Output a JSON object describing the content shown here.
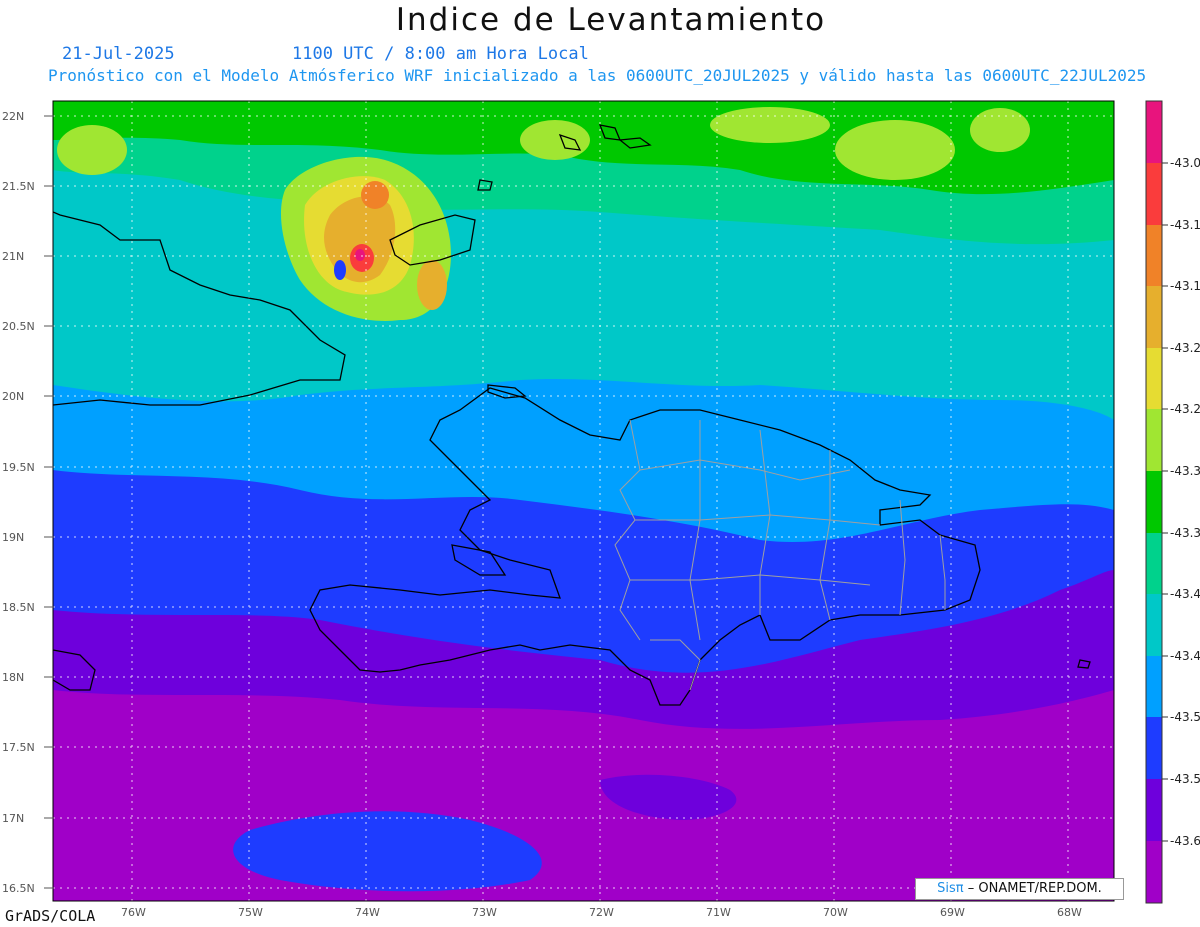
{
  "title": "Indice de Levantamiento",
  "date": "21-Jul-2025",
  "time": "1100 UTC / 8:00 am Hora Local",
  "description": "Pronóstico con el Modelo Atmósferico WRF inicializado a las 0600UTC_20JUL2025 y válido hasta las  0600UTC_22JUL2025",
  "footer": "GrADS/COLA",
  "credit": {
    "logo": "Sisπ",
    "text": "– ONAMET/REP.DOM."
  },
  "map": {
    "lat_labels": [
      "22N",
      "21.5N",
      "21N",
      "20.5N",
      "20N",
      "19.5N",
      "19N",
      "18.5N",
      "18N",
      "17.5N",
      "17N",
      "16.5N"
    ],
    "lon_labels": [
      "76W",
      "75W",
      "74W",
      "73W",
      "72W",
      "71W",
      "70W",
      "69W",
      "68W"
    ]
  },
  "colorbar": {
    "labels": [
      "-43.0",
      "-43.1",
      "-43.1",
      "-43.2",
      "-43.2",
      "-43.3",
      "-43.3",
      "-43.4",
      "-43.4",
      "-43.5",
      "-43.5",
      "-43.6"
    ],
    "colors": [
      "#e8147d",
      "#fa3c3c",
      "#f08228",
      "#e6af2d",
      "#e6dc32",
      "#a0e632",
      "#00c800",
      "#00d28c",
      "#00c8c8",
      "#00a0ff",
      "#1e3cff",
      "#6e00dc",
      "#a000c8"
    ]
  }
}
